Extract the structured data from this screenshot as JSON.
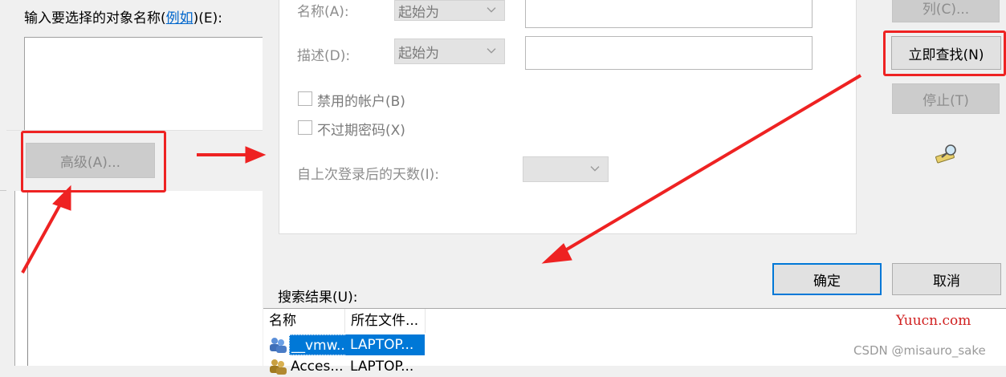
{
  "back_dialog": {
    "label_prefix": "输入要选择的对象名称(",
    "label_link": "例如",
    "label_suffix": ")(E):",
    "advanced_button": "高级(A)..."
  },
  "query": {
    "name_label": "名称(A):",
    "name_combo": "起始为",
    "desc_label": "描述(D):",
    "desc_combo": "起始为",
    "disabled_accounts": "禁用的帐户(B)",
    "non_expiring_password": "不过期密码(X)",
    "days_since_logon": "自上次登录后的天数(I):"
  },
  "buttons": {
    "columns": "列(C)...",
    "find_now": "立即查找(N)",
    "stop": "停止(T)",
    "ok": "确定",
    "cancel": "取消"
  },
  "results": {
    "label": "搜索结果(U):",
    "columns": [
      "名称",
      "所在文件..."
    ],
    "rows": [
      {
        "name": "__vmw...",
        "folder": "LAPTOP..."
      },
      {
        "name": "Acces...",
        "folder": "LAPTOP..."
      }
    ]
  },
  "watermarks": {
    "site": "Yuucn.com",
    "csdn": "CSDN @misauro_sake"
  },
  "colors": {
    "accent": "#0078d7",
    "annotation_red": "#ee2222"
  }
}
